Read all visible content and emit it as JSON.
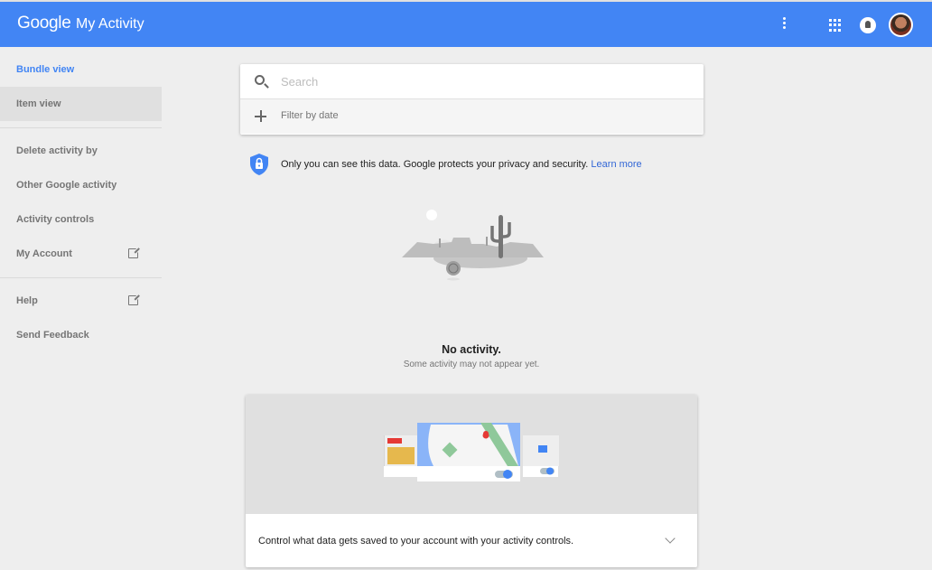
{
  "header": {
    "logo": "Google",
    "title": "My Activity",
    "icons": [
      "more-vert-icon",
      "apps-icon",
      "notifications-icon",
      "avatar"
    ]
  },
  "sidebar": {
    "items": [
      {
        "label": "Bundle view",
        "state": "active"
      },
      {
        "label": "Item view",
        "state": "selected"
      },
      {
        "label": "Delete activity by"
      },
      {
        "label": "Other Google activity"
      },
      {
        "label": "Activity controls"
      },
      {
        "label": "My Account",
        "icon": "open-in-new-icon"
      },
      {
        "label": "Help",
        "icon": "open-in-new-icon"
      },
      {
        "label": "Send Feedback"
      }
    ]
  },
  "search": {
    "placeholder": "Search",
    "value": "",
    "filter_label": "Filter by date"
  },
  "privacy": {
    "text": "Only you can see this data. Google protects your privacy and security.",
    "link": "Learn more"
  },
  "empty_state": {
    "title": "No activity.",
    "subtitle": "Some activity may not appear yet."
  },
  "controls_card": {
    "text": "Control what data gets saved to your account with your activity controls."
  },
  "colors": {
    "brand": "#4285f4",
    "link": "#3367d6",
    "background": "#eeeeee"
  }
}
